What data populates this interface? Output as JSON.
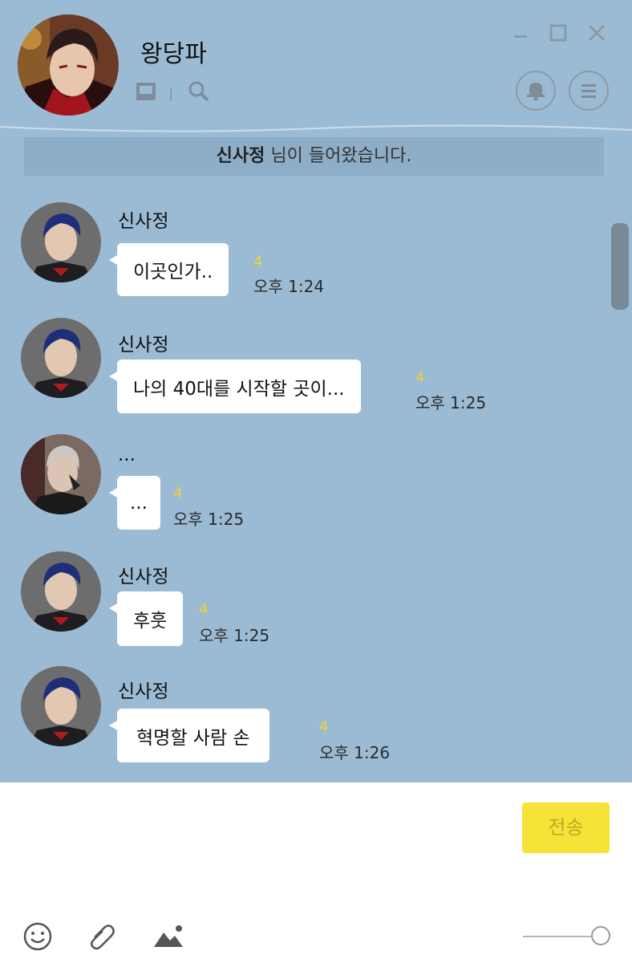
{
  "window": {
    "minimize_label": "minimize",
    "maximize_label": "maximize",
    "close_label": "close"
  },
  "header": {
    "title": "왕당파"
  },
  "notice": {
    "name": "신사정",
    "text": " 님이 들어왔습니다."
  },
  "messages": [
    {
      "sender": "신사정",
      "text": "이곳인가..",
      "unread": "4",
      "time": "오후 1:24"
    },
    {
      "sender": "신사정",
      "text": "나의 40대를 시작할 곳이...",
      "unread": "4",
      "time": "오후 1:25"
    },
    {
      "sender": "...",
      "text": "...",
      "unread": "4",
      "time": "오후 1:25"
    },
    {
      "sender": "신사정",
      "text": "후훗",
      "unread": "4",
      "time": "오후 1:25"
    },
    {
      "sender": "신사정",
      "text": "혁명할 사람 손",
      "unread": "4",
      "time": "오후 1:26"
    }
  ],
  "composer": {
    "send_label": "전송"
  },
  "colors": {
    "background": "#9bbbd4",
    "bubble": "#ffffff",
    "unread": "#f2d22e",
    "send_button": "#f5e437"
  },
  "icons": [
    "inbox-icon",
    "search-icon",
    "bell-icon",
    "menu-icon",
    "emoji-icon",
    "paperclip-icon",
    "image-icon"
  ]
}
